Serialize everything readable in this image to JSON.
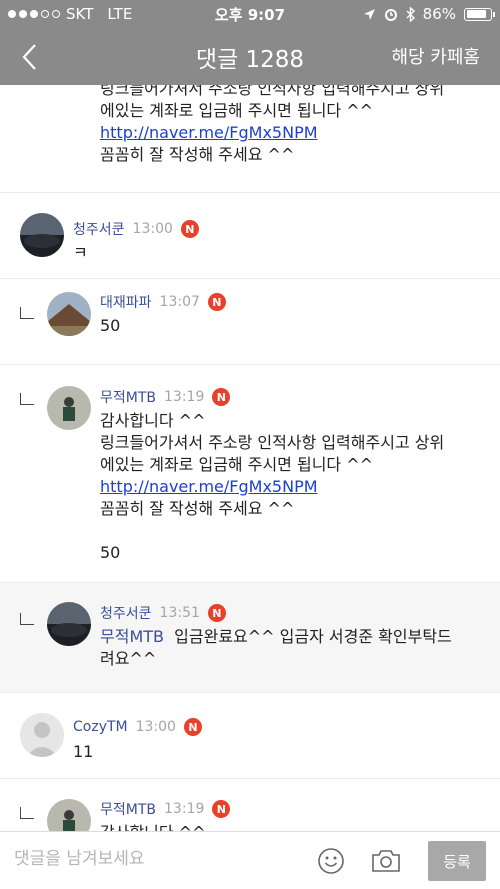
{
  "status_bar": {
    "carrier": "SKT",
    "network": "LTE",
    "time": "오후 9:07",
    "battery": "86%",
    "battery_level": 0.86
  },
  "nav": {
    "title": "댓글 1288",
    "cafe_home": "해당 카페홈"
  },
  "badge_label": "N",
  "comments": [
    {
      "lines": [
        "링크들어가셔서  주소랑 인적사항 입력해주시고 상위",
        "에있는 계좌로 입금해 주시면 됩니다 ^^"
      ],
      "link": "http://naver.me/FgMx5NPM",
      "after": "꼼꼼히 잘 작성해 주세요 ^^"
    },
    {
      "author": "청주서쿤",
      "time": "13:00",
      "text": "ㅋ"
    },
    {
      "author": "대재파파",
      "time": "13:07",
      "text": "50"
    },
    {
      "author": "무적MTB",
      "time": "13:19",
      "lines": [
        "감사합니다 ^^",
        "링크들어가셔서  주소랑 인적사항 입력해주시고 상위",
        "에있는 계좌로 입금해 주시면 됩니다 ^^"
      ],
      "link": "http://naver.me/FgMx5NPM",
      "after": "꼼꼼히 잘 작성해 주세요 ^^",
      "extra": "50"
    },
    {
      "author": "청주서쿤",
      "time": "13:51",
      "mention": "무적MTB",
      "text_line1": "입금완료요^^ 입금자 서경준 확인부탁드",
      "text_line2": "려요^^"
    },
    {
      "author": "CozyTM",
      "time": "13:00",
      "text": "11"
    },
    {
      "author": "무적MTB",
      "time": "13:19",
      "text": "감사합니다 ^^"
    }
  ],
  "input": {
    "placeholder": "댓글을 남겨보세요",
    "submit": "등록"
  }
}
